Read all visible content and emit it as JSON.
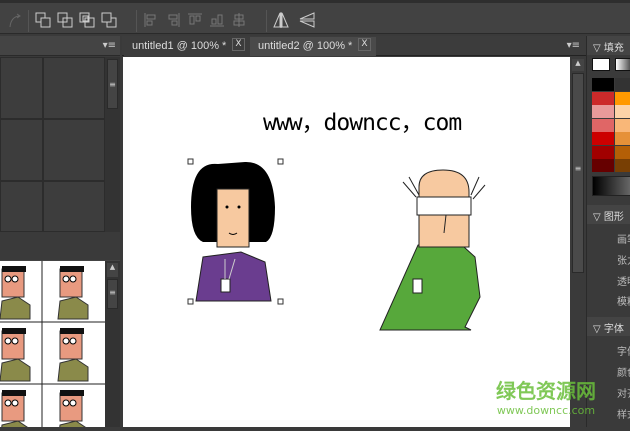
{
  "tabs": [
    {
      "label": "untitled1 @ 100% *",
      "close": "X"
    },
    {
      "label": "untitled2 @ 100% *",
      "close": "X"
    }
  ],
  "canvas": {
    "text": "www，downcc，com"
  },
  "right_panel": {
    "fill_header": "▽ 填充",
    "shape_header": "▽ 图形",
    "shape_items": [
      "画笔",
      "张力",
      "透明",
      "模糊"
    ],
    "font_header": "▽ 字体",
    "font_items": [
      "字体",
      "颜色",
      "对齐",
      "样式"
    ],
    "swatches": [
      "#000000",
      "#333333",
      "#cc2a2a",
      "#ff9900",
      "#e89a9a",
      "#fcd3a8",
      "#e06666",
      "#f9b778",
      "#cc0000",
      "#e69138",
      "#a10000",
      "#b45f06",
      "#660000",
      "#783f04"
    ]
  },
  "watermark": {
    "title": "绿色资源网",
    "url": "www.downcc.com"
  }
}
